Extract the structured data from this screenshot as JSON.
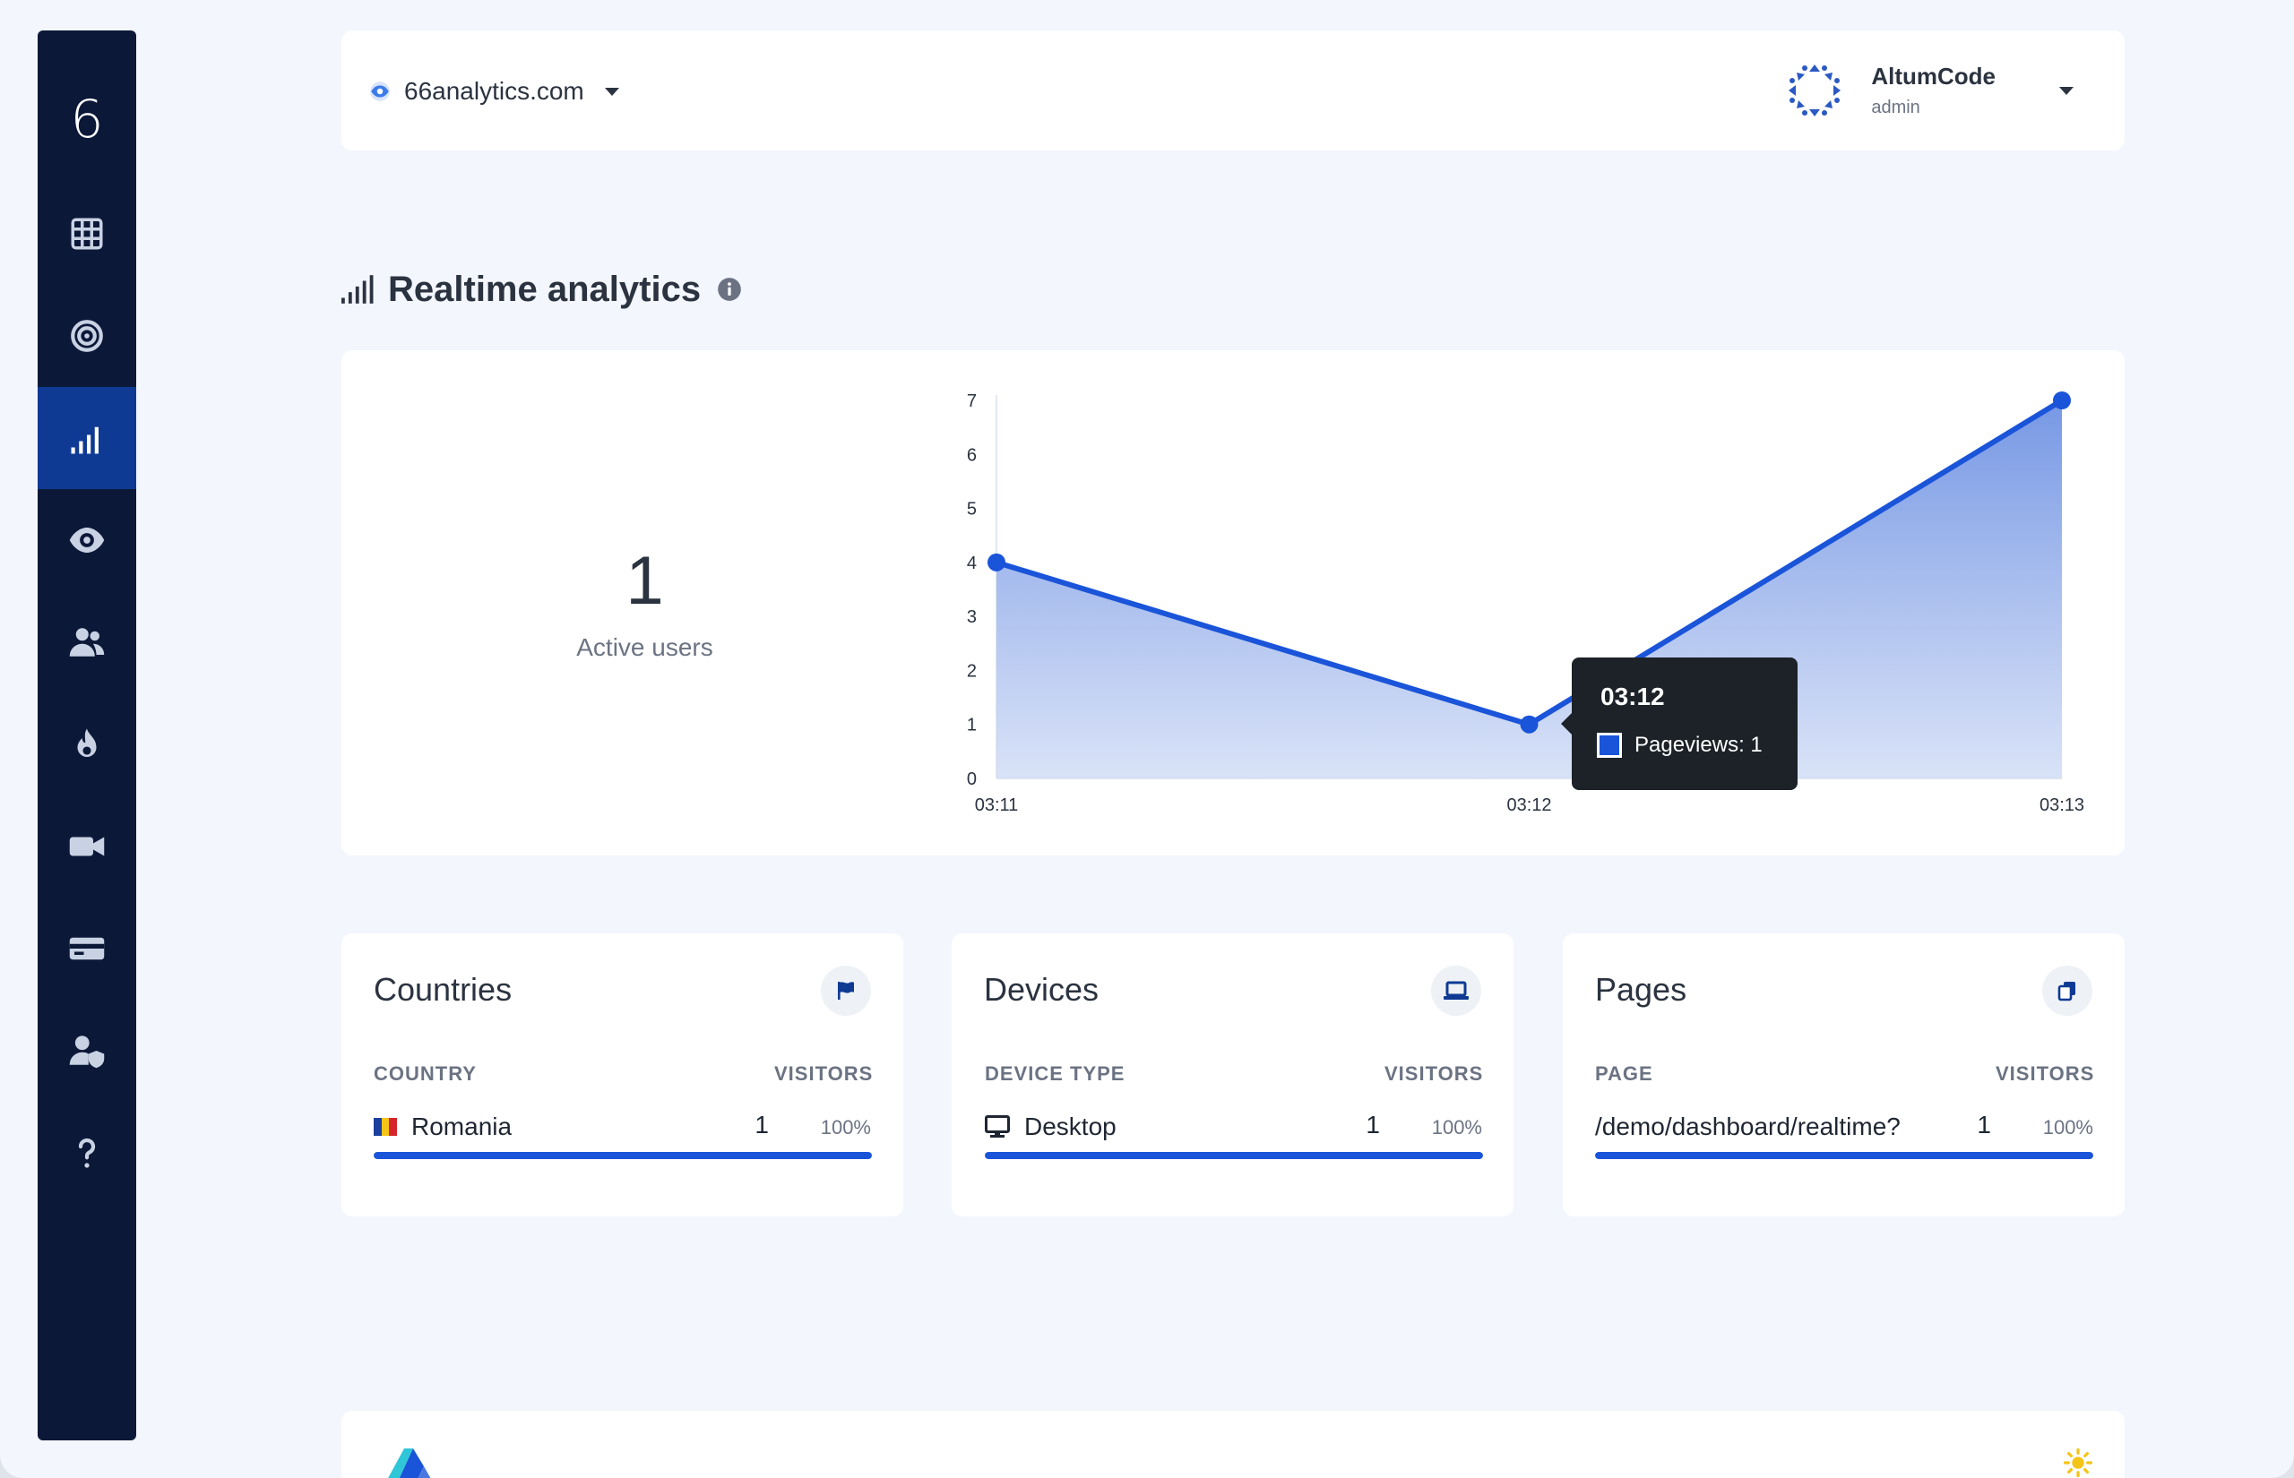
{
  "sidebar": {
    "logo": "6",
    "items": [
      {
        "icon": "grid-icon",
        "name": "sidebar-item-websites",
        "active": false
      },
      {
        "icon": "target-icon",
        "name": "sidebar-item-goals",
        "active": false
      },
      {
        "icon": "signal-icon",
        "name": "sidebar-item-realtime",
        "active": true
      },
      {
        "icon": "eye-icon",
        "name": "sidebar-item-visitors",
        "active": false
      },
      {
        "icon": "users-icon",
        "name": "sidebar-item-users",
        "active": false
      },
      {
        "icon": "fire-icon",
        "name": "sidebar-item-heatmaps",
        "active": false
      },
      {
        "icon": "video-icon",
        "name": "sidebar-item-replays",
        "active": false
      },
      {
        "icon": "card-icon",
        "name": "sidebar-item-billing",
        "active": false
      },
      {
        "icon": "user-shield-icon",
        "name": "sidebar-item-admin",
        "active": false
      },
      {
        "icon": "question-icon",
        "name": "sidebar-item-help",
        "active": false
      }
    ]
  },
  "header": {
    "site": "66analytics.com",
    "user_name": "AltumCode",
    "user_role": "admin"
  },
  "page": {
    "title": "Realtime analytics"
  },
  "realtime": {
    "active_users": "1",
    "active_users_label": "Active users"
  },
  "chart_data": {
    "type": "area",
    "x": [
      "03:11",
      "03:12",
      "03:13"
    ],
    "series": [
      {
        "name": "Pageviews",
        "values": [
          4,
          1,
          7
        ]
      }
    ],
    "ylim": [
      0,
      7
    ],
    "yticks": [
      0,
      1,
      2,
      3,
      4,
      5,
      6,
      7
    ],
    "grid": false,
    "tooltip": {
      "title": "03:12",
      "label": "Pageviews: 1"
    },
    "colors": {
      "line": "#1a54d9",
      "fill": "#7d9ee6"
    }
  },
  "countries": {
    "title": "Countries",
    "col_label": "COUNTRY",
    "col_value": "VISITORS",
    "rows": [
      {
        "label": "Romania",
        "count": "1",
        "pct": "100%",
        "fill": 1.0
      }
    ]
  },
  "devices": {
    "title": "Devices",
    "col_label": "DEVICE TYPE",
    "col_value": "VISITORS",
    "rows": [
      {
        "label": "Desktop",
        "count": "1",
        "pct": "100%",
        "fill": 1.0
      }
    ]
  },
  "pages": {
    "title": "Pages",
    "col_label": "PAGE",
    "col_value": "VISITORS",
    "rows": [
      {
        "label": "/demo/dashboard/realtime?",
        "count": "1",
        "pct": "100%",
        "fill": 1.0
      }
    ]
  },
  "colors": {
    "sidebar_bg": "#0b1838",
    "sidebar_active": "#0f3a94",
    "accent": "#1a54d9",
    "page_bg": "#f3f6fc"
  }
}
